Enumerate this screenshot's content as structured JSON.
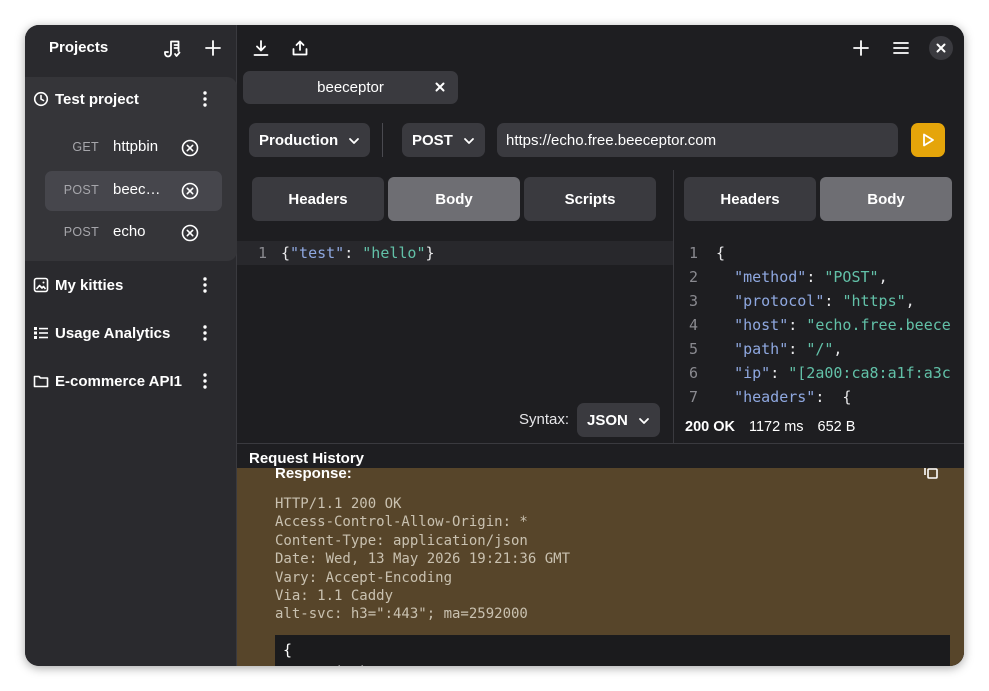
{
  "sidebar": {
    "title": "Projects",
    "projects": [
      {
        "name": "Test project",
        "icon": "clock-icon",
        "requests": [
          {
            "method": "GET",
            "name": "httpbin"
          },
          {
            "method": "POST",
            "name": "beec…"
          },
          {
            "method": "POST",
            "name": "echo"
          }
        ]
      },
      {
        "name": "My kitties",
        "icon": "image-icon"
      },
      {
        "name": "Usage Analytics",
        "icon": "list-icon"
      },
      {
        "name": "E-commerce API1",
        "icon": "folder-icon"
      }
    ]
  },
  "tab": {
    "label": "beeceptor"
  },
  "request": {
    "environment": "Production",
    "method": "POST",
    "url": "https://echo.free.beeceptor.com",
    "tabs": [
      "Headers",
      "Body",
      "Scripts"
    ],
    "active_tab": "Body",
    "body_line_number": "1",
    "body": "{\"test\": \"hello\"}",
    "syntax_label": "Syntax:",
    "syntax_value": "JSON"
  },
  "response": {
    "tabs": [
      "Headers",
      "Body"
    ],
    "active_tab": "Body",
    "lines": [
      {
        "n": "1",
        "text": "{"
      },
      {
        "n": "2",
        "key": "\"method\"",
        "value": "\"POST\"",
        "tail": ","
      },
      {
        "n": "3",
        "key": "\"protocol\"",
        "value": "\"https\"",
        "tail": ","
      },
      {
        "n": "4",
        "key": "\"host\"",
        "value": "\"echo.free.beece",
        "tail": ""
      },
      {
        "n": "5",
        "key": "\"path\"",
        "value": "\"/\"",
        "tail": ","
      },
      {
        "n": "6",
        "key": "\"ip\"",
        "value": "\"[2a00:ca8:a1f:a3c",
        "tail": ""
      },
      {
        "n": "7",
        "key": "\"headers\"",
        "value": "",
        "tail": " {"
      }
    ],
    "status": "200 OK",
    "time": "1172 ms",
    "size": "652 B"
  },
  "history": {
    "title": "Request History",
    "response_label": "Response:",
    "raw": "HTTP/1.1 200 OK\nAccess-Control-Allow-Origin: *\nContent-Type: application/json\nDate: Wed, 13 May 2026 19:21:36 GMT\nVary: Accept-Encoding\nVia: 1.1 Caddy\nalt-svc: h3=\":443\"; ma=2592000",
    "body_preview": "{\n  \"method\": \"POST\","
  },
  "colors": {
    "accent": "#e5a50a",
    "history_bg": "#57452a",
    "window_bg": "#1e1e21",
    "sidebar_bg": "#2a2a2e"
  }
}
